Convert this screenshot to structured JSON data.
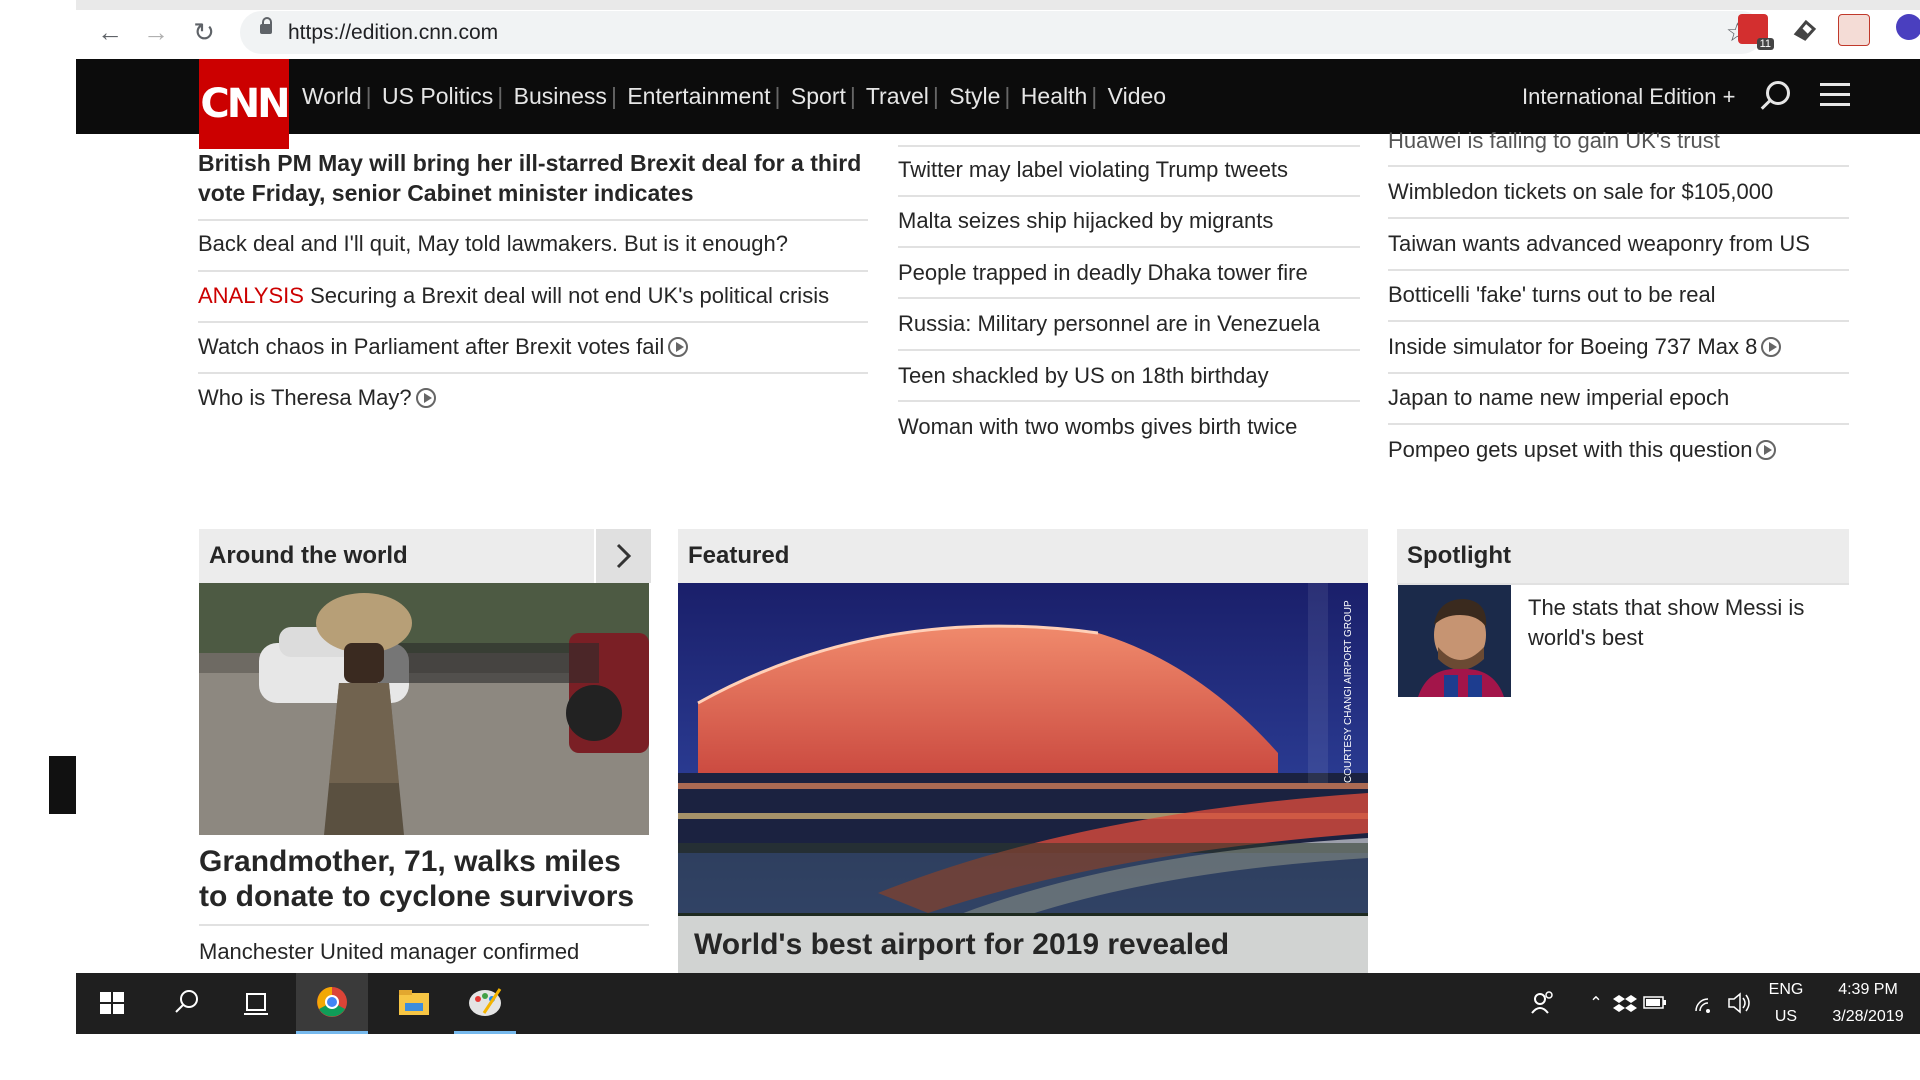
{
  "browser": {
    "url": "https://edition.cnn.com",
    "ext_badge": "11"
  },
  "cnn_nav": {
    "logo": "CNN",
    "links": [
      "World",
      "US Politics",
      "Business",
      "Entertainment",
      "Sport",
      "Travel",
      "Style",
      "Health",
      "Video"
    ],
    "edition": "International Edition +"
  },
  "left_col": {
    "lead": "British PM May will bring her ill-starred Brexit deal for a third vote Friday, senior Cabinet minister indicates",
    "items": [
      {
        "text": "Back deal and I'll quit, May told lawmakers. But is it enough?"
      },
      {
        "prefix": "ANALYSIS",
        "text": "Securing a Brexit deal will not end UK's political crisis"
      },
      {
        "text": "Watch chaos in Parliament after Brexit votes fail",
        "video": true
      },
      {
        "text": "Who is Theresa May?",
        "video": true
      }
    ]
  },
  "mid_col": {
    "items": [
      "Twitter may label violating Trump tweets",
      "Malta seizes ship hijacked by migrants",
      "People trapped in deadly Dhaka tower fire",
      "Russia: Military personnel are in Venezuela",
      "Teen shackled by US on 18th birthday",
      "Woman with two wombs gives birth twice"
    ]
  },
  "right_col": {
    "items": [
      {
        "text": "Huawei is failing to gain UK's trust"
      },
      {
        "text": "Wimbledon tickets on sale for $105,000"
      },
      {
        "text": "Taiwan wants advanced weaponry from US"
      },
      {
        "text": "Botticelli 'fake' turns out to be real"
      },
      {
        "text": "Inside simulator for Boeing 737 Max 8",
        "video": true
      },
      {
        "text": "Japan to name new imperial epoch"
      },
      {
        "text": "Pompeo gets upset with this question",
        "video": true
      }
    ]
  },
  "sections": {
    "around": {
      "title": "Around the world",
      "headline": "Grandmother, 71, walks miles to donate to cyclone survivors",
      "sub": "Manchester United manager confirmed"
    },
    "featured": {
      "title": "Featured",
      "caption": "World's best airport for 2019 revealed",
      "credit": "COURTESY CHANGI AIRPORT GROUP"
    },
    "spotlight": {
      "title": "Spotlight",
      "headline": "The stats that show Messi is world's best"
    }
  },
  "taskbar": {
    "lang1": "ENG",
    "lang2": "US",
    "time": "4:39 PM",
    "date": "3/28/2019"
  },
  "colors": {
    "cnn_red": "#cc0000",
    "nav_bg": "#0c0c0c",
    "analysis_red": "#cc0000"
  }
}
